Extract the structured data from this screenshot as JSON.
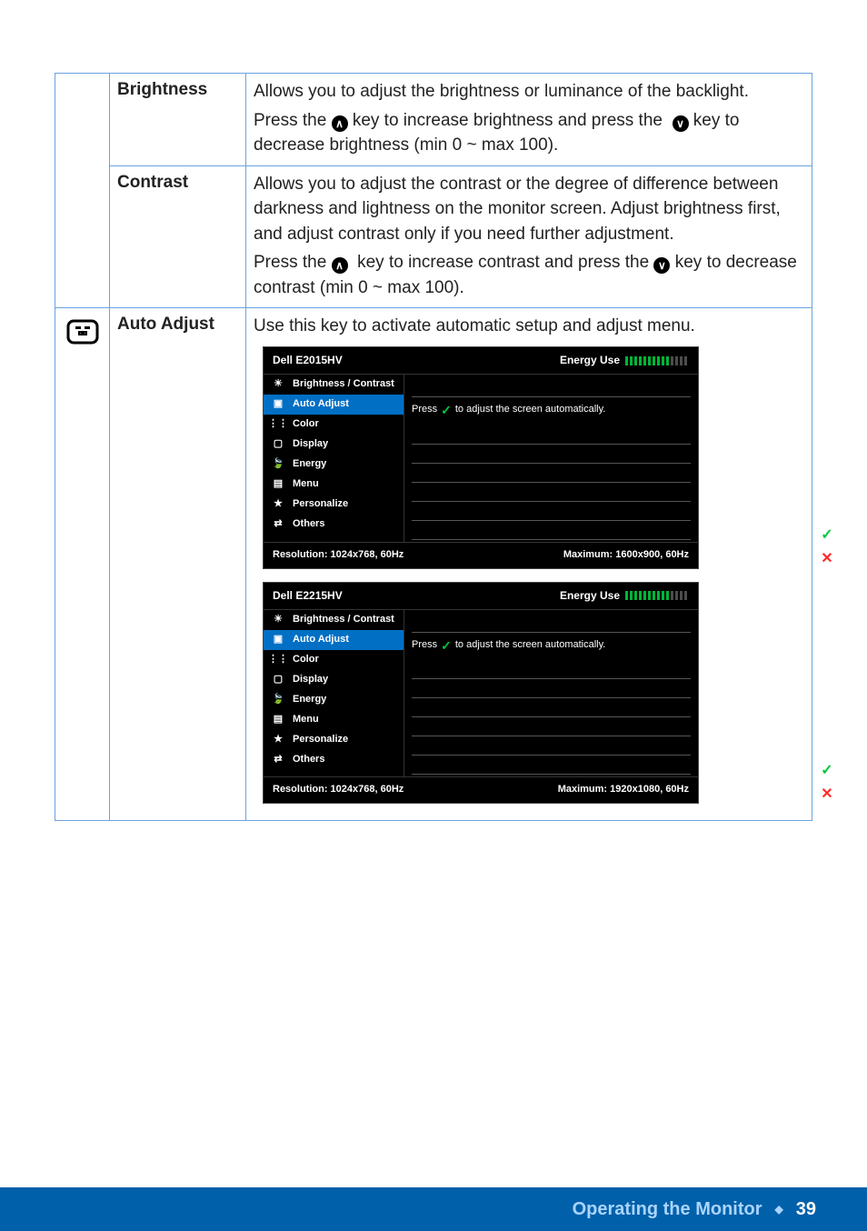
{
  "rows": {
    "brightness": {
      "label": "Brightness",
      "desc": "Allows you to adjust the brightness or luminance of the backlight.",
      "press_pre": "Press the ",
      "press_mid": " key to increase brightness and press the ",
      "press_post": " key to decrease brightness (min 0 ~ max 100)."
    },
    "contrast": {
      "label": "Contrast",
      "desc": "Allows you to adjust the contrast or the degree of difference between darkness and lightness on the monitor screen. Adjust brightness first, and adjust contrast only if you need further adjustment.",
      "press_pre": "Press the ",
      "press_mid": " key to increase contrast and press the ",
      "press_post": " key to decrease contrast (min 0 ~ max 100)."
    },
    "autoadjust": {
      "label": "Auto Adjust",
      "desc": "Use this key to activate automatic setup and adjust menu."
    }
  },
  "osd_menu": {
    "items": [
      "Brightness / Contrast",
      "Auto Adjust",
      "Color",
      "Display",
      "Energy",
      "Menu",
      "Personalize",
      "Others"
    ],
    "energy_label": "Energy Use",
    "press_pre": "Press ",
    "press_post": " to adjust the screen automatically.",
    "res_label": "Resolution: 1024x768, 60Hz"
  },
  "osd1": {
    "model": "Dell E2015HV",
    "max": "Maximum: 1600x900, 60Hz"
  },
  "osd2": {
    "model": "Dell E2215HV",
    "max": "Maximum: 1920x1080, 60Hz"
  },
  "footer": {
    "title": "Operating the Monitor",
    "page": "39"
  }
}
